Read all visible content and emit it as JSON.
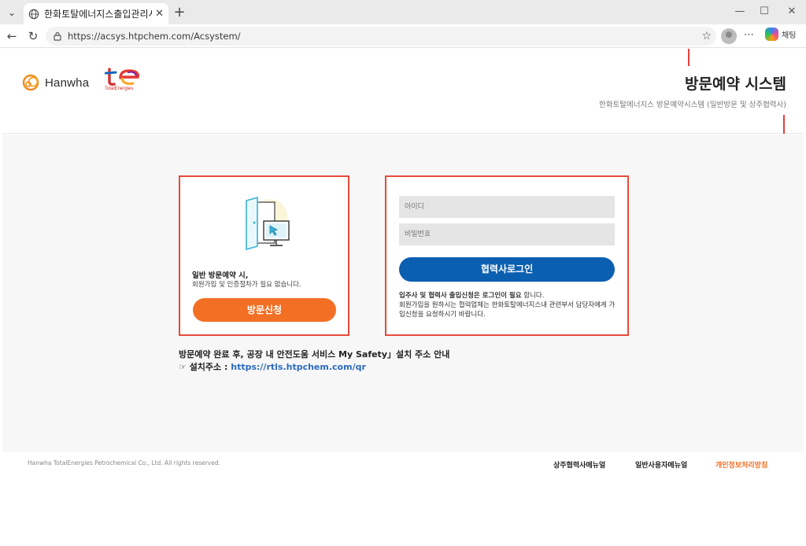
{
  "browser": {
    "tab_title": "한화토탈에너지스출입관리시스템",
    "url": "https://acsys.htpchem.com/Acsystem/",
    "copilot_label": "채팅"
  },
  "header": {
    "brand_hanwha": "Hanwha",
    "brand_te_caption": "TotalEnergies",
    "title": "방문예약 시스템",
    "subtitle": "한화토탈에너지스 방문예약시스템 (일반방문 및 상주협력사)"
  },
  "visit_card": {
    "line1": "일반 방문예약 시,",
    "line2": "회원가입 및 인증절차가 필요 없습니다.",
    "button": "방문신청"
  },
  "login_card": {
    "id_placeholder": "아이디",
    "pw_placeholder": "비밀번호",
    "button": "협력사로그인",
    "notice_bold": "입주사 및 협력사 출입신청은 로그인이 필요",
    "notice_rest": " 합니다.",
    "notice_line2": "회원가입을 원하시는 협력업체는 한화토탈에너지스내 관련부서 담당자에게 가입신청을 요청하시기 바랍니다."
  },
  "safety": {
    "line1": "방문예약 완료 후, 공장 내 안전도움 서비스 My Safety」설치 주소 안내",
    "install_label": "☞ 설치주소 : ",
    "install_url": "https://rtls.htpchem.com/qr"
  },
  "footer": {
    "copyright": "Hanwha TotalEnergies Petrochemical Co., Ltd. All rights reserved.",
    "link1": "상주협력사메뉴얼",
    "link2": "일반사용자메뉴얼",
    "link3": "개인정보처리방침"
  },
  "colors": {
    "accent_orange": "#f26f24",
    "accent_blue": "#0b5fb0",
    "card_border": "#e64a3b"
  }
}
